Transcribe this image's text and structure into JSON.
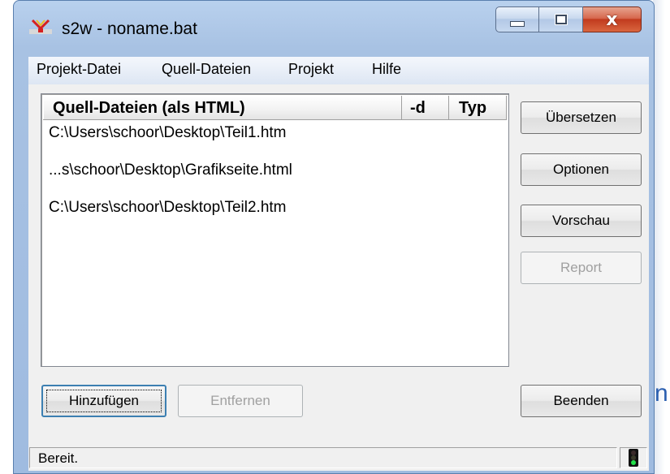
{
  "window": {
    "title": "s2w - noname.bat",
    "icons": {
      "app": "s2w-app-icon",
      "minimize": "minimize-icon",
      "maximize": "maximize-icon",
      "close": "close-icon"
    },
    "close_glyph": "x"
  },
  "background": {
    "glyph": "n"
  },
  "menu": {
    "items": [
      "Projekt-Datei",
      "Quell-Dateien",
      "Projekt",
      "Hilfe"
    ]
  },
  "list": {
    "columns": [
      "Quell-Dateien (als HTML)",
      "-d",
      "Typ"
    ],
    "rows": [
      "C:\\Users\\schoor\\Desktop\\Teil1.htm",
      "...s\\schoor\\Desktop\\Grafikseite.html",
      "C:\\Users\\schoor\\Desktop\\Teil2.htm"
    ]
  },
  "buttons": {
    "uebersetzen": "Übersetzen",
    "optionen": "Optionen",
    "vorschau": "Vorschau",
    "report": "Report",
    "hinzufuegen": "Hinzufügen",
    "entfernen": "Entfernen",
    "beenden": "Beenden"
  },
  "status": {
    "text": "Bereit.",
    "indicator": "green",
    "indicator_icon": "traffic-light-icon"
  },
  "colors": {
    "frame": "#a8c2e3",
    "close_button": "#c13b1e",
    "focus_border": "#3c7fb1",
    "indicator_green": "#23e14a"
  }
}
